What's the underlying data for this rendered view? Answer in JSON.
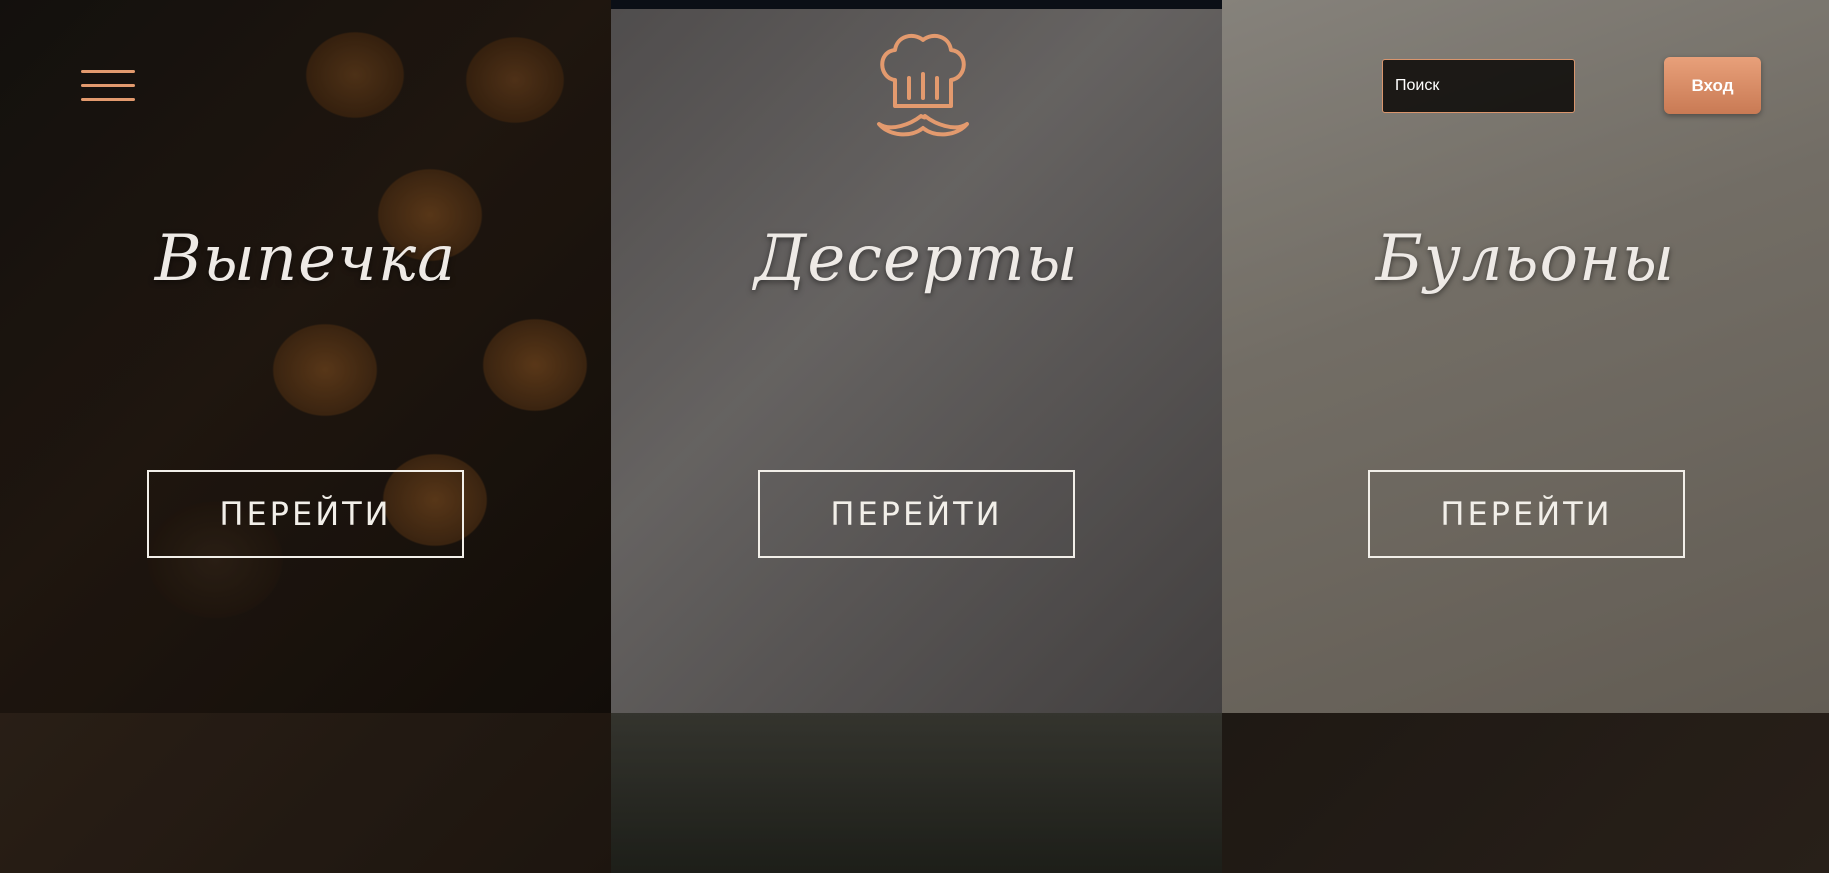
{
  "header": {
    "search_placeholder": "Поиск",
    "login_label": "Вход",
    "accent_color": "#e39a6e"
  },
  "icons": {
    "menu": "hamburger-menu-icon",
    "logo": "chef-hat-logo-icon"
  },
  "categories": [
    {
      "title": "Выпечка",
      "button": "ПЕРЕЙТИ"
    },
    {
      "title": "Десерты",
      "button": "ПЕРЕЙТИ"
    },
    {
      "title": "Бульоны",
      "button": "ПЕРЕЙТИ"
    }
  ]
}
